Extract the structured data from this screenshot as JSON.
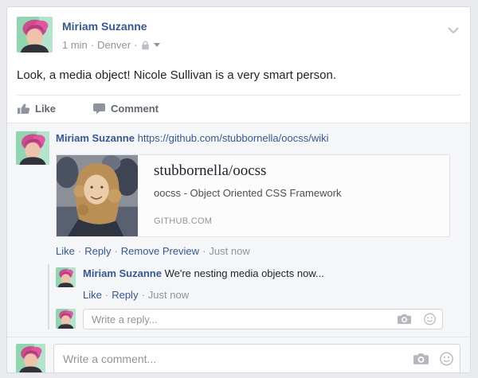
{
  "sep": "·",
  "post": {
    "author": "Miriam Suzanne",
    "time": "1 min",
    "location": "Denver",
    "body": "Look, a media object! Nicole Sullivan is a very smart person.",
    "like_label": "Like",
    "comment_label": "Comment"
  },
  "comment": {
    "author": "Miriam Suzanne",
    "link": "https://github.com/stubbornella/oocss/wiki",
    "preview": {
      "title": "stubbornella/oocss",
      "description": "oocss - Object Oriented CSS Framework",
      "source": "GITHUB.COM"
    },
    "like_label": "Like",
    "reply_label": "Reply",
    "remove_preview_label": "Remove Preview",
    "timestamp": "Just now"
  },
  "reply": {
    "author": "Miriam Suzanne",
    "body": "We're nesting media objects now...",
    "like_label": "Like",
    "reply_label": "Reply",
    "timestamp": "Just now"
  },
  "composers": {
    "reply_placeholder": "Write a reply...",
    "comment_placeholder": "Write a comment..."
  },
  "icons": {
    "privacy": "lock",
    "post_menu": "chevron-down",
    "like": "thumbs-up",
    "comment": "speech-bubble",
    "photo": "camera",
    "emoji": "smiley"
  },
  "colors": {
    "link_blue": "#365899",
    "text": "#1d2129",
    "muted_gray": "#90949c",
    "page_bg": "#e9ebee",
    "comments_bg": "#f5f6f7"
  }
}
